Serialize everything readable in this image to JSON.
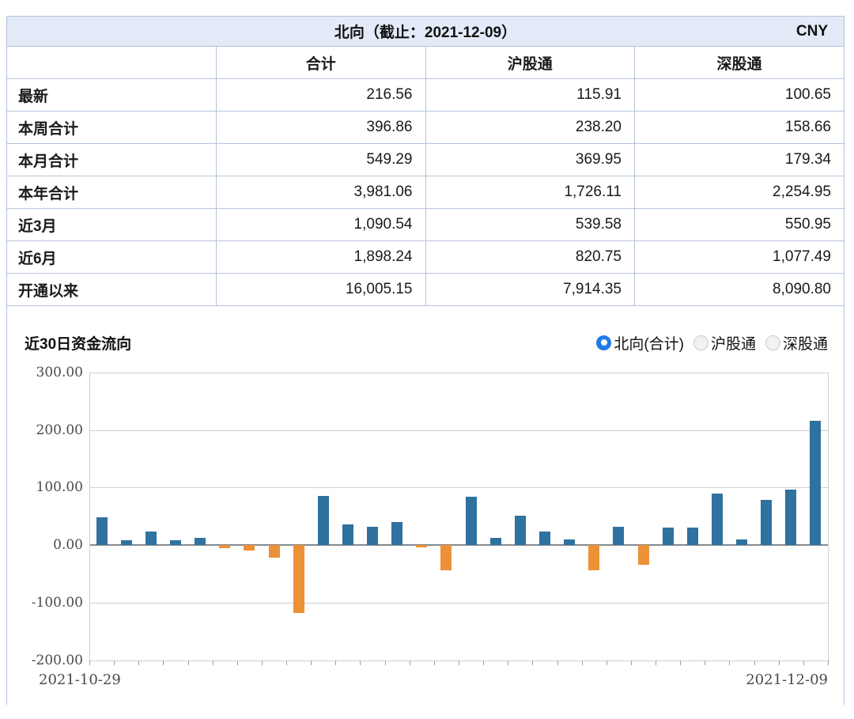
{
  "panel": {
    "title": "北向（截止：2021-12-09）",
    "currency": "CNY"
  },
  "table": {
    "columns": [
      "",
      "合计",
      "沪股通",
      "深股通"
    ],
    "rows": [
      {
        "label": "最新",
        "values": [
          "216.56",
          "115.91",
          "100.65"
        ]
      },
      {
        "label": "本周合计",
        "values": [
          "396.86",
          "238.20",
          "158.66"
        ]
      },
      {
        "label": "本月合计",
        "values": [
          "549.29",
          "369.95",
          "179.34"
        ]
      },
      {
        "label": "本年合计",
        "values": [
          "3,981.06",
          "1,726.11",
          "2,254.95"
        ]
      },
      {
        "label": "近3月",
        "values": [
          "1,090.54",
          "539.58",
          "550.95"
        ]
      },
      {
        "label": "近6月",
        "values": [
          "1,898.24",
          "820.75",
          "1,077.49"
        ]
      },
      {
        "label": "开通以来",
        "values": [
          "16,005.15",
          "7,914.35",
          "8,090.80"
        ]
      }
    ]
  },
  "chart_section": {
    "title": "近30日资金流向",
    "radios": [
      {
        "label": "北向(合计)",
        "selected": true
      },
      {
        "label": "沪股通",
        "selected": false
      },
      {
        "label": "深股通",
        "selected": false
      }
    ]
  },
  "chart_data": {
    "type": "bar",
    "title": "近30日资金流向",
    "x_axis_labels": [
      "2021-10-29",
      "2021-12-09"
    ],
    "y_tick_labels": [
      "300.00",
      "200.00",
      "100.00",
      "0.00",
      "-100.00",
      "-200.00"
    ],
    "ylim": [
      -200,
      300
    ],
    "grid": true,
    "values": [
      48,
      9,
      24,
      9,
      13,
      -6,
      -10,
      -22,
      -118,
      86,
      36,
      32,
      40,
      -4,
      -44,
      84,
      13,
      51,
      23,
      10,
      -44,
      32,
      -34,
      31,
      30,
      90,
      10,
      78,
      96,
      216.56
    ],
    "colors": {
      "positive": "#2f719f",
      "negative": "#ec9138",
      "radio_selected": "#2079e8"
    }
  }
}
